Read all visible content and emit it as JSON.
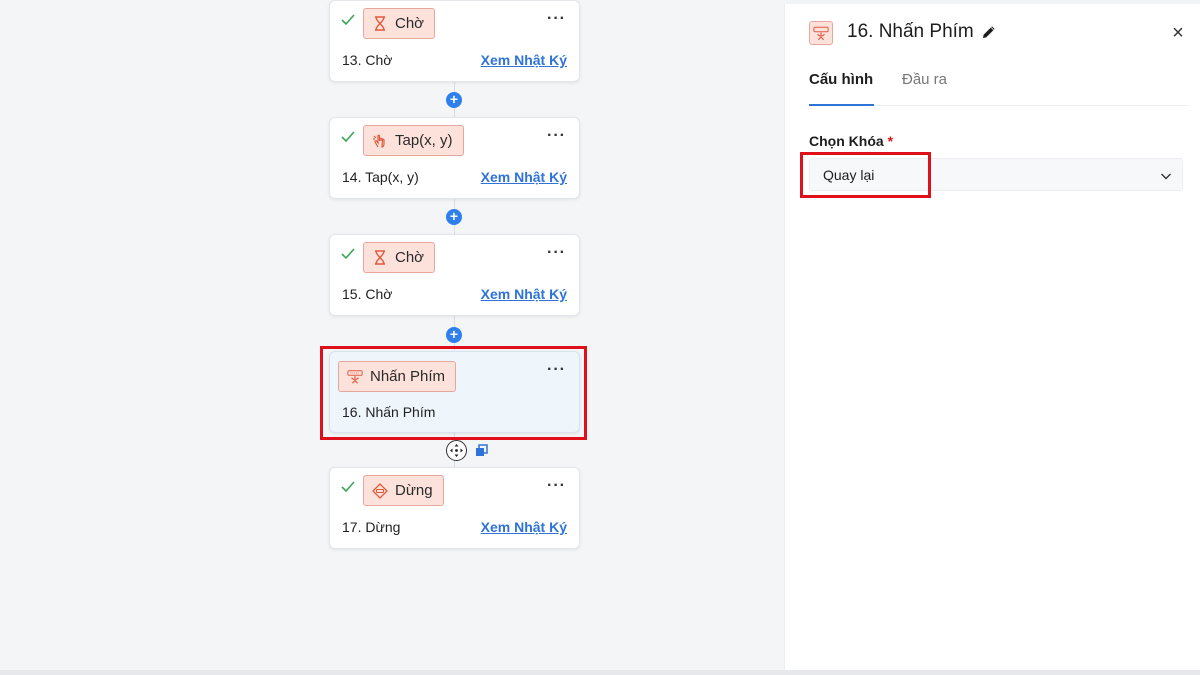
{
  "workflow": {
    "nodes": [
      {
        "badge": "Chờ",
        "icon": "hourglass-icon",
        "title": "13. Chờ",
        "log_link": "Xem Nhật Ký",
        "status": "done"
      },
      {
        "badge": "Tap(x, y)",
        "icon": "tap-hand-icon",
        "title": "14. Tap(x, y)",
        "log_link": "Xem Nhật Ký",
        "status": "done"
      },
      {
        "badge": "Chờ",
        "icon": "hourglass-icon",
        "title": "15. Chờ",
        "log_link": "Xem Nhật Ký",
        "status": "done"
      },
      {
        "badge": "Nhấn Phím",
        "icon": "key-press-icon",
        "title": "16. Nhấn Phím",
        "status": "selected"
      },
      {
        "badge": "Dừng",
        "icon": "stop-sign-icon",
        "title": "17. Dừng",
        "log_link": "Xem Nhật Ký",
        "status": "done"
      }
    ],
    "menu_glyph": "···",
    "add_glyph": "+"
  },
  "panel": {
    "title": "16. Nhấn Phím",
    "tabs": [
      {
        "label": "Cấu hình",
        "active": true
      },
      {
        "label": "Đầu ra",
        "active": false
      }
    ],
    "field": {
      "label": "Chọn Khóa",
      "required_mark": "*",
      "value": "Quay lại"
    },
    "close_glyph": "×"
  },
  "colors": {
    "accent": "#2f73d9",
    "badge_bg": "#fde2dc",
    "badge_border": "#e8a79c",
    "highlight": "#e0101a",
    "success": "#3aa657"
  }
}
